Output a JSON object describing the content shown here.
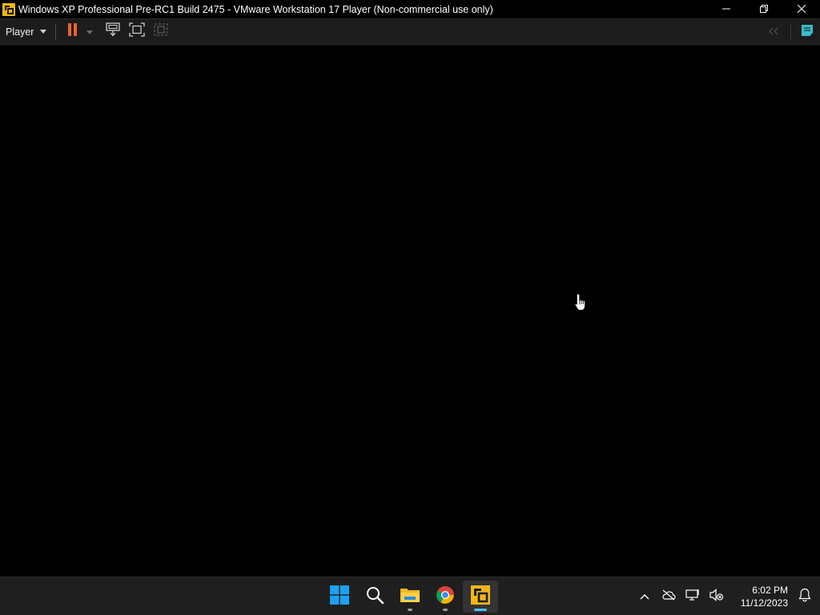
{
  "window": {
    "title": "Windows XP Professional Pre-RC1 Build 2475 - VMware Workstation 17 Player (Non-commercial use only)",
    "controls": {
      "minimize": "minimize-icon",
      "restore": "restore-icon",
      "close": "close-icon"
    }
  },
  "toolbar": {
    "player_label": "Player",
    "buttons": [
      "pause-icon",
      "dropdown-caret-icon",
      "send-ctrl-alt-del-icon",
      "full-screen-icon",
      "unity-icon"
    ],
    "right_buttons": [
      "collapse-toolbar-icon",
      "message-log-icon"
    ],
    "colors": {
      "pause": "#e8642c",
      "accent": "#3eb8c9"
    }
  },
  "taskbar": {
    "apps": [
      {
        "name": "Start",
        "icon": "windows-start-icon"
      },
      {
        "name": "Search",
        "icon": "search-icon"
      },
      {
        "name": "File Explorer",
        "icon": "folder-icon"
      },
      {
        "name": "Google Chrome",
        "icon": "chrome-icon"
      },
      {
        "name": "VMware Workstation Player",
        "icon": "vmware-icon",
        "active": true
      }
    ],
    "tray": [
      "chevron-up-icon",
      "onedrive-offline-icon",
      "network-icon",
      "volume-muted-icon",
      "notification-bell-icon"
    ],
    "clock": {
      "time": "6:02 PM",
      "date": "11/12/2023"
    },
    "colors": {
      "active_indicator": "#4cc2ff"
    }
  }
}
